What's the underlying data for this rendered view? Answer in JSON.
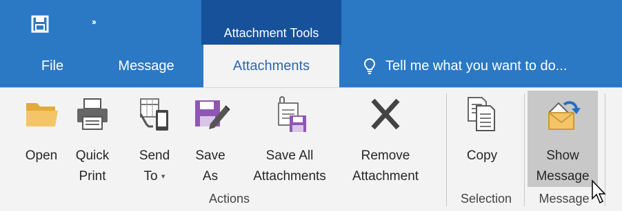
{
  "quick_access": {
    "save_icon": "save-icon",
    "more_label": "››"
  },
  "contextual_header": "Attachment Tools",
  "tabs": [
    {
      "label": "File"
    },
    {
      "label": "Message"
    },
    {
      "label": "Attachments",
      "active": true
    }
  ],
  "tell_me": {
    "text": "Tell me what you want to do...",
    "icon": "lightbulb-icon"
  },
  "groups": {
    "actions": {
      "label": "Actions",
      "buttons": [
        {
          "line1": "Open",
          "line2": "",
          "icon": "folder-icon"
        },
        {
          "line1": "Quick",
          "line2": "Print",
          "icon": "printer-icon"
        },
        {
          "line1": "Send",
          "line2": "To",
          "icon": "send-to-icon",
          "dropdown": "▾"
        },
        {
          "line1": "Save",
          "line2": "As",
          "icon": "save-as-icon"
        },
        {
          "line1": "Save All",
          "line2": "Attachments",
          "icon": "save-all-icon"
        },
        {
          "line1": "Remove",
          "line2": "Attachment",
          "icon": "remove-icon"
        }
      ]
    },
    "selection": {
      "label": "Selection",
      "buttons": [
        {
          "line1": "Copy",
          "line2": "",
          "icon": "copy-icon"
        }
      ]
    },
    "message": {
      "label": "Message",
      "buttons": [
        {
          "line1": "Show",
          "line2": "Message",
          "icon": "show-message-icon",
          "hovered": true
        }
      ]
    }
  },
  "colors": {
    "title_blue": "#2b78c5",
    "contextual_blue": "#17519a",
    "ribbon_bg": "#f3f3f3",
    "active_tab_text": "#2b66b3"
  }
}
